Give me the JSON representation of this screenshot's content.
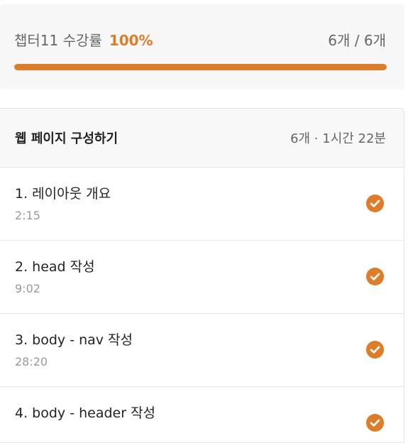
{
  "progress": {
    "label": "챕터11 수강률",
    "percent": "100%",
    "fraction": 1.0,
    "count": "6개 / 6개"
  },
  "section": {
    "title": "웹 페이지 구성하기",
    "meta": "6개 · 1시간 22분",
    "lessons": [
      {
        "title": "1. 레이아웃 개요",
        "duration": "2:15",
        "completed": true
      },
      {
        "title": "2. head 작성",
        "duration": "9:02",
        "completed": true
      },
      {
        "title": "3. body - nav 작성",
        "duration": "28:20",
        "completed": true
      },
      {
        "title": "4. body - header 작성",
        "duration": "",
        "completed": true
      }
    ]
  },
  "colors": {
    "accent": "#dd7d2a",
    "muted_text": "#666666",
    "duration_text": "#9a9a9a"
  },
  "icons": {
    "completed": "check-circle-icon"
  }
}
